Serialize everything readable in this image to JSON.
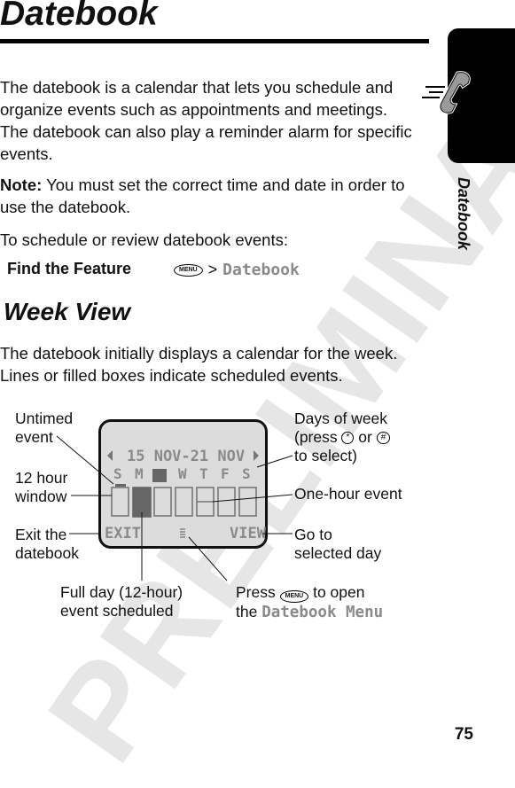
{
  "page": {
    "title": "Datebook",
    "side_tab_label": "Datebook",
    "page_number": "75",
    "watermark": "PRELIMINARY"
  },
  "intro": {
    "paragraph": "The datebook is a calendar that lets you schedule and organize events such as appointments and meetings. The datebook can also play a reminder alarm for specific events.",
    "note_label": "Note:",
    "note_text": " You must set the correct time and date in order to use the datebook.",
    "instruction": "To schedule or review datebook events:"
  },
  "find_feature": {
    "label": "Find the Feature",
    "key": "MENU",
    "separator": ">",
    "target": "Datebook"
  },
  "week_view": {
    "heading": "Week View",
    "paragraph": "The datebook initially displays a calendar for the week. Lines or filled boxes indicate scheduled events."
  },
  "phone_screen": {
    "date_range": "15 NOV-21 NOV",
    "days": [
      "S",
      "M",
      "T",
      "W",
      "T",
      "F",
      "S"
    ],
    "selected_day_index": 2,
    "left_softkey": "EXIT",
    "right_softkey": "VIEW",
    "menu_indicator": "menu-icon"
  },
  "annotations": {
    "untimed_event": [
      "Untimed",
      "event"
    ],
    "twelve_hour_window": [
      "12 hour",
      "window"
    ],
    "exit_datebook": [
      "Exit the",
      "datebook"
    ],
    "days_of_week_1": "Days of week",
    "days_of_week_2_pre": "(press ",
    "days_of_week_key1": "*",
    "days_of_week_mid": " or ",
    "days_of_week_key2": "#",
    "days_of_week_3": "to select)",
    "one_hour_event": "One-hour event",
    "go_to_day": [
      "Go to",
      "selected day"
    ],
    "full_day": [
      "Full day (12-hour)",
      "event scheduled"
    ],
    "press_menu_pre": "Press ",
    "press_menu_key": "MENU",
    "press_menu_post": " to open",
    "press_menu_the": "the ",
    "press_menu_target": "Datebook Menu"
  }
}
